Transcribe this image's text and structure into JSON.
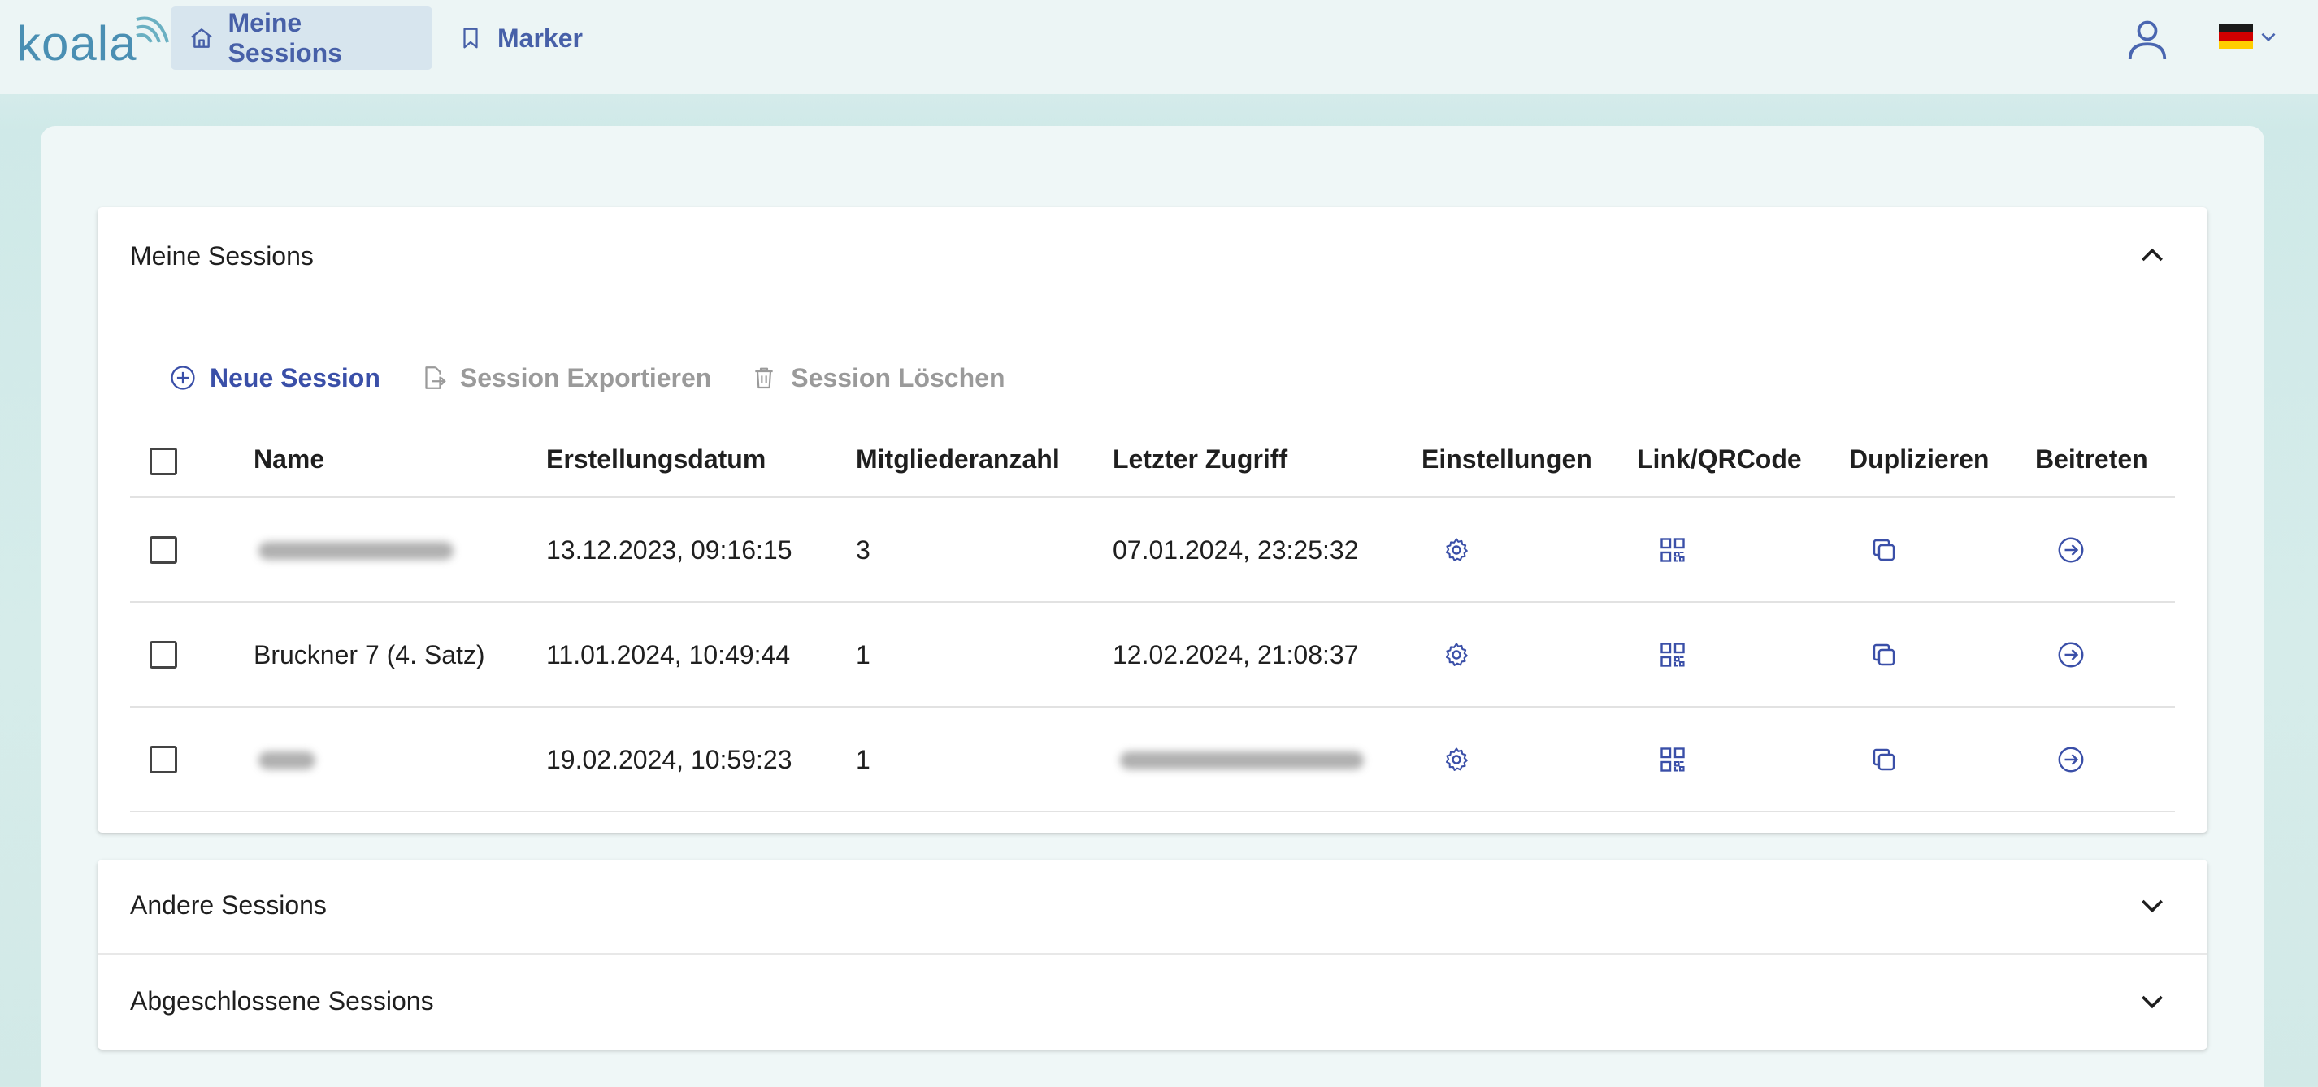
{
  "app": {
    "logo_text": "koala",
    "nav": [
      {
        "label": "Meine Sessions",
        "icon": "home-icon",
        "active": true
      },
      {
        "label": "Marker",
        "icon": "bookmark-icon",
        "active": false
      }
    ],
    "language_flag": "de-flag-icon"
  },
  "colors": {
    "accent": "#3a4fa8",
    "nav_active_bg": "#d7e5ee",
    "disabled": "#9a9a9a",
    "background": "#d2e9e7"
  },
  "my_sessions": {
    "title": "Meine Sessions",
    "toolbar": {
      "new": "Neue Session",
      "export": "Session Exportieren",
      "delete": "Session Löschen"
    },
    "columns": [
      "Name",
      "Erstellungsdatum",
      "Mitgliederanzahl",
      "Letzter Zugriff",
      "Einstellungen",
      "Link/QRCode",
      "Duplizieren",
      "Beitreten"
    ],
    "rows": [
      {
        "name": "",
        "created": "13.12.2023, 09:16:15",
        "members": "3",
        "last_access": "07.01.2024, 23:25:32"
      },
      {
        "name": "Bruckner 7 (4. Satz)",
        "created": "11.01.2024, 10:49:44",
        "members": "1",
        "last_access": "12.02.2024, 21:08:37"
      },
      {
        "name": "",
        "created": "19.02.2024, 10:59:23",
        "members": "1",
        "last_access": ""
      }
    ]
  },
  "other_sessions": {
    "title": "Andere Sessions"
  },
  "closed_sessions": {
    "title": "Abgeschlossene Sessions"
  }
}
